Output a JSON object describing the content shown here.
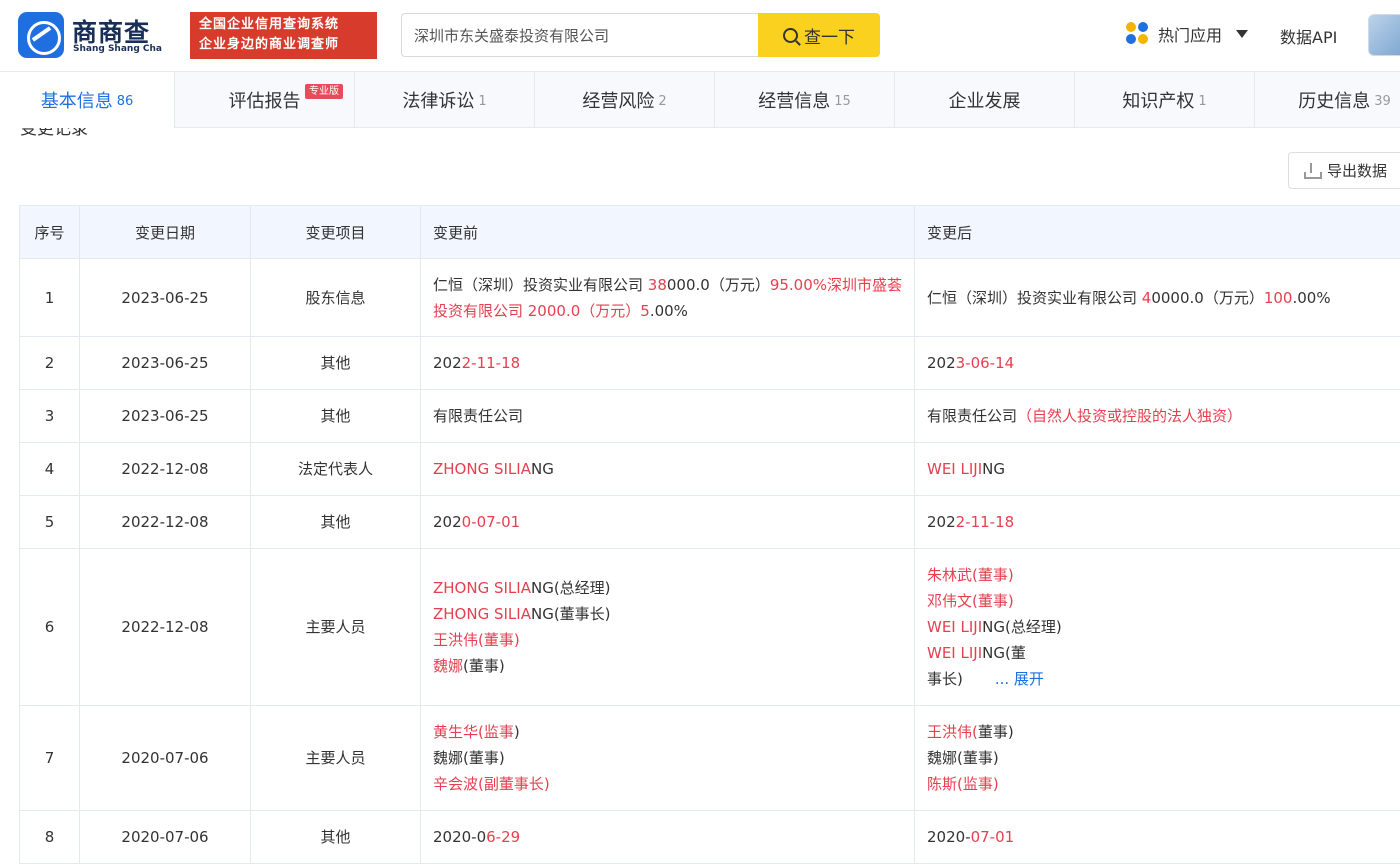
{
  "header": {
    "logo_name": "商商查",
    "logo_sub": "Shang Shang Cha",
    "slogan_line1": "全国企业信用查询系统",
    "slogan_line2": "企业身边的商业调查师",
    "search_value": "深圳市东关盛泰投资有限公司",
    "search_button": "查一下",
    "hot_apps": "热门应用",
    "data_api": "数据API"
  },
  "tabs": [
    {
      "label": "基本信息",
      "count": "86"
    },
    {
      "label": "评估报告",
      "count": ""
    },
    {
      "label": "法律诉讼",
      "count": "1"
    },
    {
      "label": "经营风险",
      "count": "2"
    },
    {
      "label": "经营信息",
      "count": "15"
    },
    {
      "label": "企业发展",
      "count": ""
    },
    {
      "label": "知识产权",
      "count": "1"
    },
    {
      "label": "历史信息",
      "count": "39"
    }
  ],
  "pro_badge": "专业版",
  "section_title_partial": "变更记录",
  "export_button": "导出数据",
  "table": {
    "headers": [
      "序号",
      "变更日期",
      "变更项目",
      "变更前",
      "变更后"
    ],
    "rows": [
      {
        "no": "1",
        "date": "2023-06-25",
        "item": "股东信息",
        "before": [
          [
            "仁恒（深圳）投资实业有限公司 ",
            ""
          ],
          [
            "38",
            "r"
          ],
          [
            "000.0（万元）",
            ""
          ],
          [
            "95.00%深圳市盛荟投资有限公司 2000.0（万元）5",
            "r"
          ],
          [
            ".00%",
            ""
          ]
        ],
        "after": [
          [
            "仁恒（深圳）投资实业有限公司 ",
            ""
          ],
          [
            "4",
            "r"
          ],
          [
            "0000.0（万元）",
            ""
          ],
          [
            "100",
            "r"
          ],
          [
            ".00%",
            ""
          ]
        ]
      },
      {
        "no": "2",
        "date": "2023-06-25",
        "item": "其他",
        "before": [
          [
            "202",
            ""
          ],
          [
            "2-11-18",
            "r"
          ]
        ],
        "after": [
          [
            "202",
            ""
          ],
          [
            "3-06-14",
            "r"
          ]
        ]
      },
      {
        "no": "3",
        "date": "2023-06-25",
        "item": "其他",
        "before": [
          [
            "有限责任公司",
            ""
          ]
        ],
        "after": [
          [
            "有限责任公司",
            ""
          ],
          [
            "（自然人投资或控股的法人独资）",
            "r"
          ]
        ]
      },
      {
        "no": "4",
        "date": "2022-12-08",
        "item": "法定代表人",
        "before": [
          [
            "ZHONG SILIA",
            "r"
          ],
          [
            "NG",
            ""
          ]
        ],
        "after": [
          [
            "WEI LIJI",
            "r"
          ],
          [
            "NG",
            ""
          ]
        ]
      },
      {
        "no": "5",
        "date": "2022-12-08",
        "item": "其他",
        "before": [
          [
            "202",
            ""
          ],
          [
            "0-07-01",
            "r"
          ]
        ],
        "after": [
          [
            "202",
            ""
          ],
          [
            "2-11-18",
            "r"
          ]
        ]
      },
      {
        "no": "6",
        "date": "2022-12-08",
        "item": "主要人员",
        "before_lines": [
          [
            [
              "ZHONG SILIA",
              "r"
            ],
            [
              "NG(总经理)",
              ""
            ]
          ],
          [
            [
              "ZHONG SILIA",
              "r"
            ],
            [
              "NG(董事长)",
              ""
            ]
          ],
          [
            [
              "王洪伟(董事)",
              "r"
            ]
          ],
          [
            [
              "魏娜",
              "r"
            ],
            [
              "(董事)",
              ""
            ]
          ]
        ],
        "after_lines": [
          [
            [
              "朱林武(董事)",
              "r"
            ]
          ],
          [
            [
              "邓伟文(董事)",
              "r"
            ]
          ],
          [
            [
              "WEI LIJI",
              "r"
            ],
            [
              "NG(总经理)",
              ""
            ]
          ],
          [
            [
              "WEI LIJI",
              "r"
            ],
            [
              "NG(董",
              ""
            ]
          ],
          [
            [
              "事长)",
              ""
            ]
          ]
        ],
        "expand": "... 展开"
      },
      {
        "no": "7",
        "date": "2020-07-06",
        "item": "主要人员",
        "before_lines": [
          [
            [
              "黄生华(监事",
              "r"
            ],
            [
              ")",
              ""
            ]
          ],
          [
            [
              "魏娜(董事)",
              ""
            ]
          ],
          [
            [
              "辛会波(副董事长)",
              "r"
            ]
          ]
        ],
        "after_lines": [
          [
            [
              "王洪伟(",
              "r"
            ],
            [
              "董",
              ""
            ],
            [
              "事)",
              ""
            ]
          ],
          [
            [
              "魏娜(董事)",
              ""
            ]
          ],
          [
            [
              "陈斯(监事)",
              "r"
            ]
          ]
        ]
      },
      {
        "no": "8",
        "date": "2020-07-06",
        "item": "其他",
        "before": [
          [
            "2020-0",
            ""
          ],
          [
            "6-29",
            "r"
          ]
        ],
        "after": [
          [
            "2020-",
            ""
          ],
          [
            "07-01",
            "r"
          ]
        ]
      }
    ]
  }
}
